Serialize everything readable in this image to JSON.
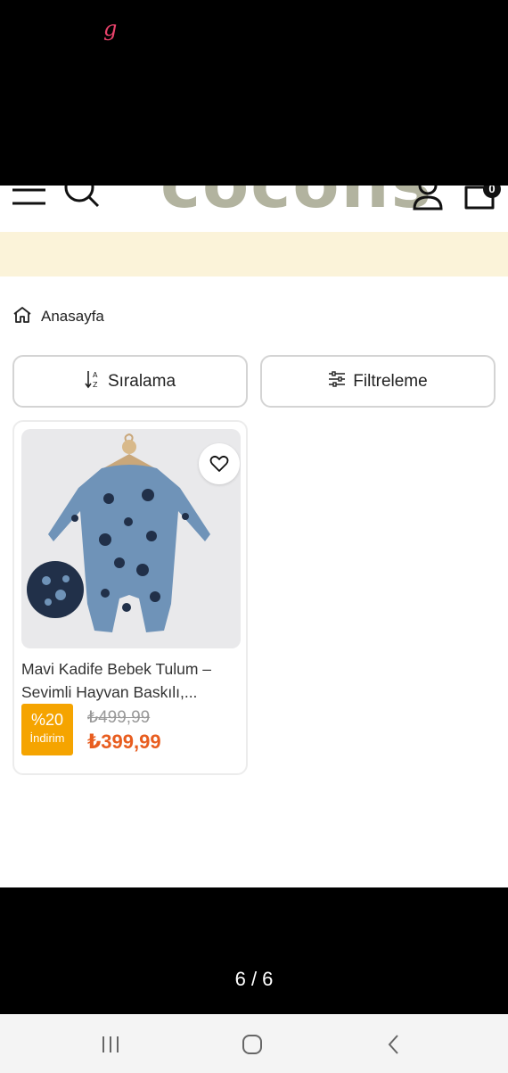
{
  "overlay": {
    "top_glyph": "g",
    "pager": "6 / 6"
  },
  "header": {
    "logo": "cocons",
    "cart_count": "0",
    "icons": [
      "menu-icon",
      "search-icon",
      "user-icon",
      "cart-icon"
    ]
  },
  "breadcrumb": {
    "home_label": "Anasayfa"
  },
  "controls": {
    "sort_label": "Sıralama",
    "filter_label": "Filtreleme"
  },
  "products": [
    {
      "title": "Mavi Kadife Bebek Tulum – Sevimli Hayvan Baskılı,...",
      "discount_pct": "%20",
      "discount_label": "İndirim",
      "old_price": "₺499,99",
      "new_price": "₺399,99"
    }
  ],
  "colors": {
    "logo": "#b2b39f",
    "announce_bar": "#fbf3d9",
    "discount_badge": "#f5a400",
    "sale_price": "#e85d1f",
    "garment": "#6f93b8"
  },
  "system_nav": [
    "recent-apps-icon",
    "home-icon",
    "back-icon"
  ]
}
